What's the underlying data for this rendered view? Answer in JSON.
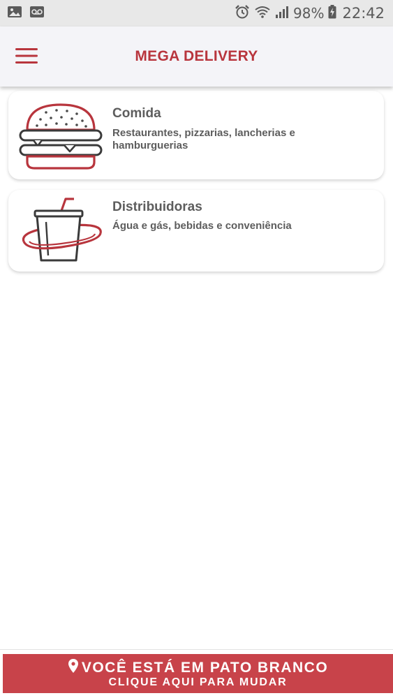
{
  "status_bar": {
    "battery": "98%",
    "time": "22:42",
    "icons": [
      "image-icon",
      "voicemail-icon",
      "alarm-icon",
      "wifi-icon",
      "signal-icon",
      "battery-charging-icon"
    ]
  },
  "app_bar": {
    "title": "MEGA DELIVERY",
    "menu_icon": "hamburger-menu-icon"
  },
  "categories": [
    {
      "title": "Comida",
      "description": "Restaurantes, pizzarias, lancherias e hamburguerias",
      "icon": "burger-icon"
    },
    {
      "title": "Distribuidoras",
      "description": "Água e gás, bebidas e conveniência",
      "icon": "soda-cup-icon"
    }
  ],
  "location_bar": {
    "line1": "VOCÊ ESTÁ EM PATO BRANCO",
    "line2": "CLIQUE AQUI PARA MUDAR",
    "icon": "map-pin-icon"
  },
  "colors": {
    "accent": "#b8353d",
    "location_bar_bg": "#c8434a",
    "text": "#5d5d5d",
    "status_bar_bg": "#e8e8e8",
    "app_bar_bg": "#f4f4f8"
  }
}
